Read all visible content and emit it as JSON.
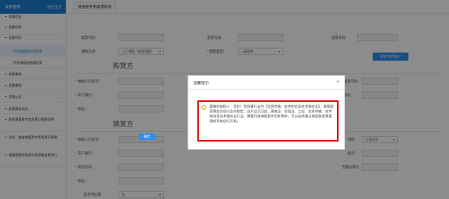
{
  "sidebar": {
    "title": "发票使用",
    "back_label": "返回主页",
    "items": [
      {
        "label": "发票验旧"
      },
      {
        "label": "发票领用"
      },
      {
        "label": "发票代开"
      },
      {
        "label": "代开增值税专用发票"
      },
      {
        "label": "代开增值税普通发票"
      },
      {
        "label": "发票缴销"
      },
      {
        "label": "发票缴销"
      },
      {
        "label": "发票认证"
      },
      {
        "label": "发票真伪检验"
      },
      {
        "label": "损失增值税专用发票已报税证明"
      },
      {
        "label": "丢失、被盗增值税专用发票已报税"
      },
      {
        "label": "增值税税控系统专用设备变更发行"
      }
    ]
  },
  "tabs": [
    {
      "label": "增值税专用发票新增"
    }
  ],
  "form": {
    "invoice_code_label": "发票代码:",
    "invoice_number_label": "发票号码:",
    "invoice_no_label": "发票号码:",
    "collect_method_label": "领取方式:",
    "collect_method_value": "上门领取（现场领取）",
    "sale_type_label": "销售类型:",
    "sale_type_value": "--请选择--",
    "add_button": "添加为常用账户",
    "buyer_section": "购货方",
    "taxpayer_id_label": "纳税人识别号:",
    "bank_label": "开户银行:",
    "address_label": "地址:",
    "phone_right_label": "电话号码:",
    "account_right_label": "账号:",
    "seller_section": "销货方",
    "seller_taxpayer_label": "纳税人识别号:",
    "seller_bank_label": "开户银行:",
    "seller_phone_label": "电话号码:",
    "seller_address_label": "地址:",
    "seller_code_label": "代码:",
    "seller_code_value": "正常代开",
    "seller_account_label": "账号:",
    "tax_certificate_label": "完税证明号:",
    "withhold_label": "是否代征税:",
    "withhold_value": "否"
  },
  "modal": {
    "title": "温馨提示",
    "close": "×",
    "icon": "warning-icon",
    "message": "尊敬的纳税人：您好！您所属行业为【信息传输、软件和信息技术服务业】，根据国家税务总局公告的规定，自开业之日起，建筑业、住宿业、工业、信息传输、软件和信息技术服务业行业，需要开具增值税专用发票的，可以选择通过增值税发票管理新系统自行开具。",
    "ok_label": "确定"
  }
}
